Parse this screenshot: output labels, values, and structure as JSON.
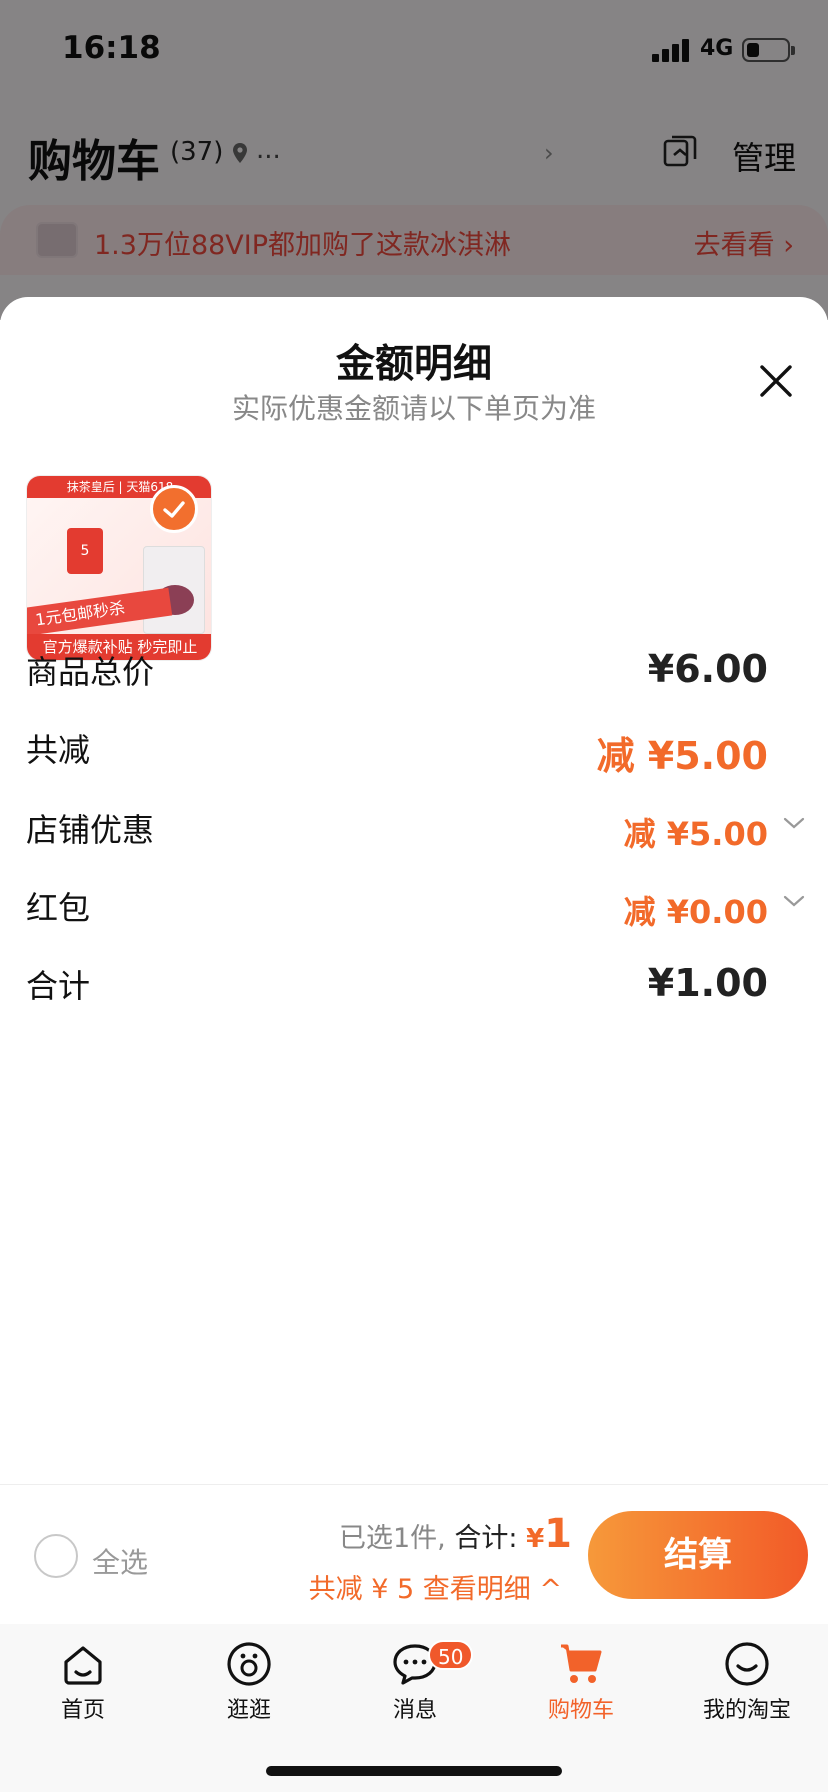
{
  "status_bar": {
    "time": "16:18",
    "network": "4G"
  },
  "cart_header": {
    "title": "购物车",
    "count": "(37)",
    "location": "...",
    "manage_label": "管理"
  },
  "promo_banner": {
    "text": "1.3万位88VIP都加购了这款冰淇淋",
    "link": "去看看 ›"
  },
  "sheet": {
    "title": "金额明细",
    "subtitle": "实际优惠金额请以下单页为准",
    "product_image": {
      "top_text": "抹茶皇后 | 天猫618",
      "badge": "5",
      "band_text": "1元包邮秒杀",
      "bottom_text": "官方爆款补贴 秒完即止"
    },
    "rows": [
      {
        "label": "商品总价",
        "value": "¥6.00"
      },
      {
        "label": "共减",
        "value": "减 ¥5.00"
      },
      {
        "label": "店铺优惠",
        "value": "减 ¥5.00"
      },
      {
        "label": "红包",
        "value": "减 ¥0.00"
      },
      {
        "label": "合计",
        "value": "¥1.00"
      }
    ]
  },
  "checkout_bar": {
    "select_all": "全选",
    "selected_text": "已选1件,",
    "total_label": "合计:",
    "currency": "¥",
    "total_amount": "1",
    "discount_text": "共减 ¥ 5",
    "detail_link": "查看明细 ^",
    "checkout_button": "结算"
  },
  "tabbar": {
    "items": [
      {
        "label": "首页",
        "icon": "home-icon"
      },
      {
        "label": "逛逛",
        "icon": "browse-icon"
      },
      {
        "label": "消息",
        "icon": "message-icon",
        "badge": "50"
      },
      {
        "label": "购物车",
        "icon": "cart-icon",
        "active": true
      },
      {
        "label": "我的淘宝",
        "icon": "profile-icon"
      }
    ]
  },
  "colors": {
    "accent": "#f26a2a",
    "promo_text": "#e9483c",
    "muted": "#888888"
  }
}
